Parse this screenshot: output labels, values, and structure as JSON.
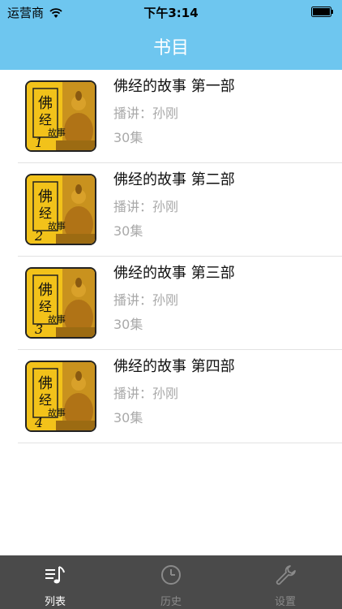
{
  "status_bar": {
    "carrier": "运营商",
    "time": "下午3:14"
  },
  "nav": {
    "title": "书目"
  },
  "books": [
    {
      "title": "佛经的故事 第一部",
      "narrator": "播讲：孙刚",
      "episodes": "30集",
      "cover_text": "佛经故事",
      "cover_number": "1"
    },
    {
      "title": "佛经的故事 第二部",
      "narrator": "播讲：孙刚",
      "episodes": "30集",
      "cover_text": "佛经故事",
      "cover_number": "2"
    },
    {
      "title": "佛经的故事 第三部",
      "narrator": "播讲：孙刚",
      "episodes": "30集",
      "cover_text": "佛经故事",
      "cover_number": "3"
    },
    {
      "title": "佛经的故事 第四部",
      "narrator": "播讲：孙刚",
      "episodes": "30集",
      "cover_text": "佛经故事",
      "cover_number": "4"
    }
  ],
  "tabs": [
    {
      "label": "列表",
      "icon": "music-list-icon",
      "active": true
    },
    {
      "label": "历史",
      "icon": "clock-icon",
      "active": false
    },
    {
      "label": "设置",
      "icon": "wrench-icon",
      "active": false
    }
  ],
  "colors": {
    "header": "#6ec6ef",
    "tabbar": "#4a4a4a",
    "cover_yellow": "#f2c21a"
  }
}
